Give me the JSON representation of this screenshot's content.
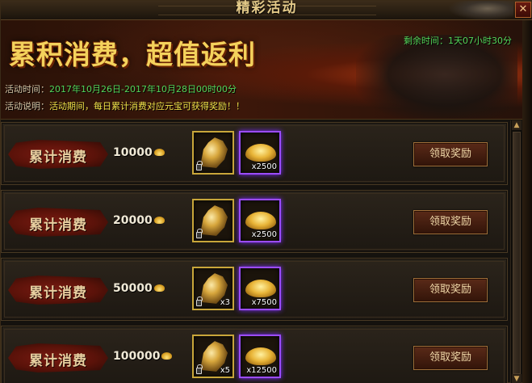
{
  "window": {
    "title": "精彩活动"
  },
  "banner": {
    "headline": "累积消费，超值返利",
    "countdown_label": "剩余时间：",
    "countdown_value": "1天07小时30分",
    "time_label": "活动时间：",
    "time_value": "2017年10月26日-2017年10月28日00时00分",
    "desc_label": "活动说明：",
    "desc_value": "活动期间，每日累计消费对应元宝可获得奖励！！"
  },
  "rows": [
    {
      "tier_label": "累计消费",
      "amount": "10000",
      "item_qty": "",
      "gold_qty": "x2500",
      "claim_label": "领取奖励"
    },
    {
      "tier_label": "累计消费",
      "amount": "20000",
      "item_qty": "",
      "gold_qty": "x2500",
      "claim_label": "领取奖励"
    },
    {
      "tier_label": "累计消费",
      "amount": "50000",
      "item_qty": "x3",
      "gold_qty": "x7500",
      "claim_label": "领取奖励"
    },
    {
      "tier_label": "累计消费",
      "amount": "100000",
      "item_qty": "x5",
      "gold_qty": "x12500",
      "claim_label": "领取奖励"
    }
  ],
  "icons": {
    "close": "close-icon",
    "ingot": "gold-ingot-icon",
    "dragon": "golden-dragon-item-icon",
    "lock": "lock-icon",
    "scroll_up": "▲",
    "scroll_down": "▼"
  },
  "colors": {
    "accent_gold": "#f4d25c",
    "countdown_green": "#54d65a",
    "desc_yellow": "#f2e24a",
    "rare_purple": "#9b4cff"
  }
}
